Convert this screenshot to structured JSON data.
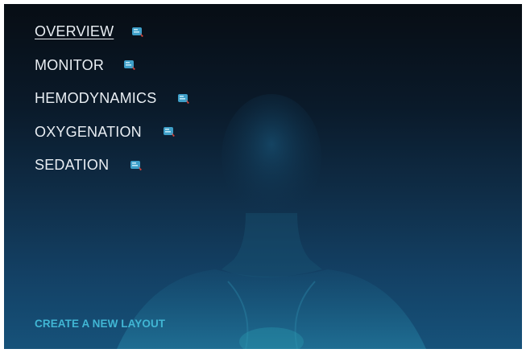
{
  "menu": {
    "items": [
      {
        "label": "OVERVIEW",
        "icon": "layout-edit-icon",
        "active": true
      },
      {
        "label": "MONITOR",
        "icon": "layout-edit-icon",
        "active": false
      },
      {
        "label": "HEMODYNAMICS",
        "icon": "layout-edit-icon",
        "active": false
      },
      {
        "label": "OXYGENATION",
        "icon": "layout-edit-icon",
        "active": false
      },
      {
        "label": "SEDATION",
        "icon": "layout-edit-icon",
        "active": false
      }
    ]
  },
  "create_layout_label": "CREATE A NEW LAYOUT",
  "colors": {
    "background_top": "#070d14",
    "background_bottom": "#16527a",
    "menu_text": "#e9eef3",
    "link": "#41b6d4",
    "icon_fill": "#3e9fc8",
    "icon_badge": "#e0453a"
  }
}
